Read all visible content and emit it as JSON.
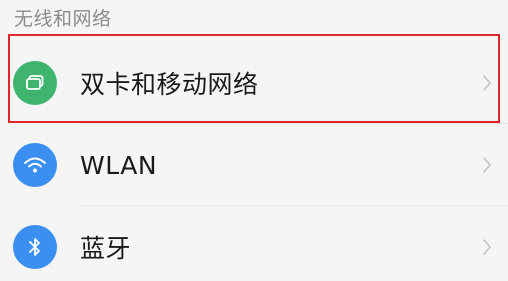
{
  "section": {
    "title": "无线和网络"
  },
  "items": [
    {
      "label": "双卡和移动网络",
      "icon": "sim-card-icon",
      "icon_color": "#3fb46e"
    },
    {
      "label": "WLAN",
      "icon": "wifi-icon",
      "icon_color": "#3a8ff0"
    },
    {
      "label": "蓝牙",
      "icon": "bluetooth-icon",
      "icon_color": "#3a8ff0"
    }
  ],
  "highlight_color": "#e0262b"
}
